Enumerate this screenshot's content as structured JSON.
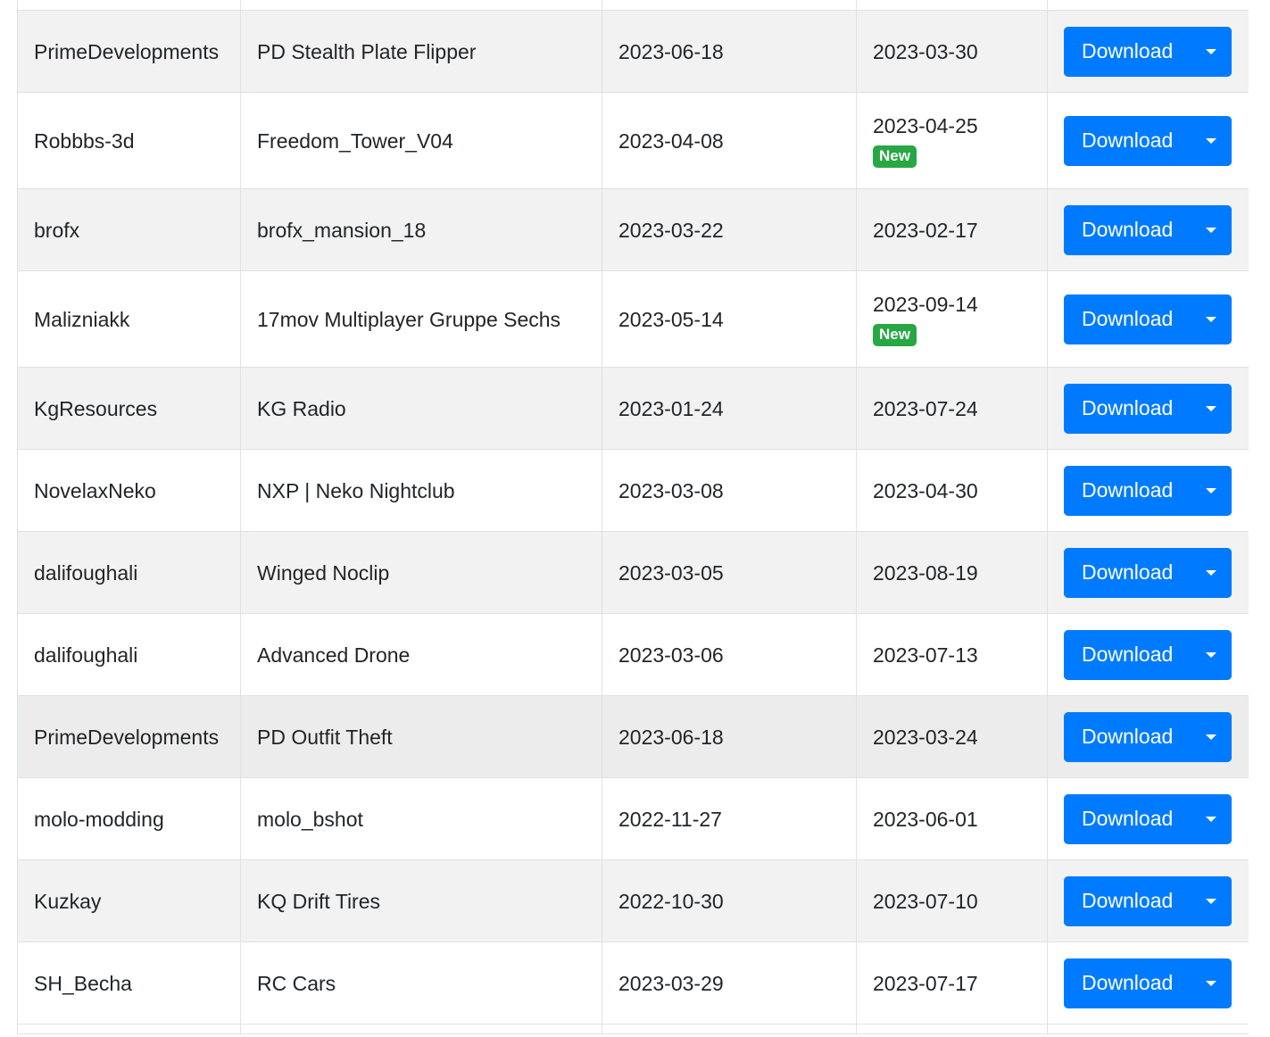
{
  "table": {
    "download_label": "Download",
    "new_badge": "New",
    "rows": [
      {
        "author": "PrimeDevelopments",
        "name": "PD Stealth Plate Flipper",
        "created": "2023-06-18",
        "updated": "2023-03-30",
        "is_new": false
      },
      {
        "author": "Robbbs-3d",
        "name": "Freedom_Tower_V04",
        "created": "2023-04-08",
        "updated": "2023-04-25",
        "is_new": true
      },
      {
        "author": "brofx",
        "name": "brofx_mansion_18",
        "created": "2023-03-22",
        "updated": "2023-02-17",
        "is_new": false
      },
      {
        "author": "Malizniakk",
        "name": "17mov Multiplayer Gruppe Sechs",
        "created": "2023-05-14",
        "updated": "2023-09-14",
        "is_new": true
      },
      {
        "author": "KgResources",
        "name": "KG Radio",
        "created": "2023-01-24",
        "updated": "2023-07-24",
        "is_new": false
      },
      {
        "author": "NovelaxNeko",
        "name": "NXP | Neko Nightclub",
        "created": "2023-03-08",
        "updated": "2023-04-30",
        "is_new": false
      },
      {
        "author": "dalifoughali",
        "name": "Winged Noclip",
        "created": "2023-03-05",
        "updated": "2023-08-19",
        "is_new": false
      },
      {
        "author": "dalifoughali",
        "name": "Advanced Drone",
        "created": "2023-03-06",
        "updated": "2023-07-13",
        "is_new": false
      },
      {
        "author": "PrimeDevelopments",
        "name": "PD Outfit Theft",
        "created": "2023-06-18",
        "updated": "2023-03-24",
        "is_new": false
      },
      {
        "author": "molo-modding",
        "name": "molo_bshot",
        "created": "2022-11-27",
        "updated": "2023-06-01",
        "is_new": false
      },
      {
        "author": "Kuzkay",
        "name": "KQ Drift Tires",
        "created": "2022-10-30",
        "updated": "2023-07-10",
        "is_new": false
      },
      {
        "author": "SH_Becha",
        "name": "RC Cars",
        "created": "2023-03-29",
        "updated": "2023-07-17",
        "is_new": false
      }
    ]
  },
  "colors": {
    "primary": "#007bff",
    "success": "#28a745",
    "stripe": "#f2f2f2",
    "hover": "#ececec",
    "border": "#dee2e6"
  }
}
